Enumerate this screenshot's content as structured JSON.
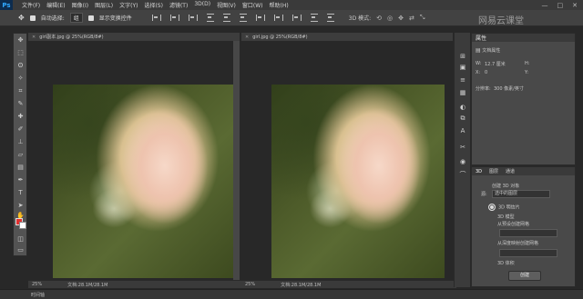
{
  "menubar": {
    "logo": "Ps",
    "items": [
      "文件(F)",
      "编辑(E)",
      "图像(I)",
      "图层(L)",
      "文字(Y)",
      "选择(S)",
      "滤镜(T)",
      "3D(D)",
      "视图(V)",
      "窗口(W)",
      "帮助(H)"
    ],
    "window_controls": [
      "—",
      "□",
      "✕"
    ]
  },
  "optionsbar": {
    "auto_select_label": "自动选择:",
    "auto_select_value": "组",
    "show_transform_label": "显示变换控件",
    "mode_3d_label": "3D 模式:"
  },
  "watermark": "网易云课堂",
  "documents": [
    {
      "tab_title": "girl副本.jpg @ 25%(RGB/8#)",
      "zoom": "25%",
      "doc_size": "文档:28.1M/28.1M"
    },
    {
      "tab_title": "girl.jpg @ 25%(RGB/8#)",
      "zoom": "25%",
      "doc_size": "文档:28.1M/28.1M"
    }
  ],
  "properties": {
    "tabs": [
      "属性"
    ],
    "doc_icon_label": "文档属性",
    "w_label": "W:",
    "w_value": "12.7 厘米",
    "h_label": "H:",
    "h_value": "",
    "x_label": "X:",
    "x_value": "0",
    "y_label": "Y:",
    "y_value": "",
    "resolution_label": "分辨率:",
    "resolution_value": "300 像素/英寸"
  },
  "panel3d": {
    "tabs": [
      "3D",
      "图层",
      "通道"
    ],
    "new_3d_object_label": "创建 3D 对象",
    "source_label": "源:",
    "source_value": "选中的图层",
    "options": [
      {
        "label": "3D 明信片",
        "selected": true
      },
      {
        "label": "3D 模型",
        "selected": false
      },
      {
        "label": "从预设创建网格",
        "selected": false
      },
      {
        "label": "从深度映射创建网格",
        "selected": false
      },
      {
        "label": "3D 体积",
        "selected": false
      }
    ],
    "create_button": "创建"
  },
  "bottom_status": "时间轴"
}
